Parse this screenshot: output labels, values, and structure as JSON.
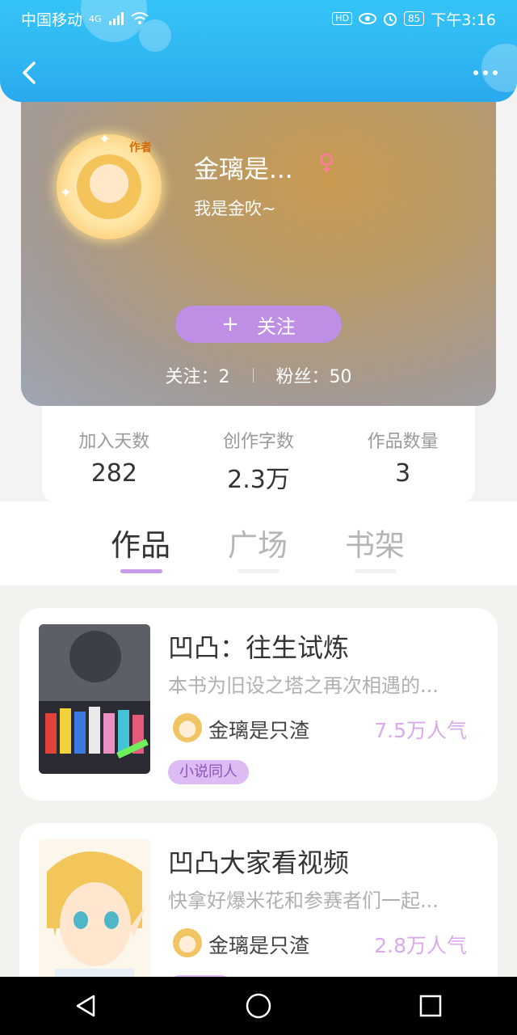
{
  "status_bar": {
    "carrier": "中国移动",
    "network": "4G",
    "hd": "HD",
    "battery": "85",
    "time": "下午3:16"
  },
  "profile": {
    "author_badge": "作者",
    "name": "金璃是...",
    "gender_symbol": "♀",
    "bio": "我是金吹~",
    "follow_plus": "+",
    "follow_label": "关注",
    "following": "关注：2",
    "fans": "粉丝：50"
  },
  "stats": [
    {
      "label": "加入天数",
      "value": "282"
    },
    {
      "label": "创作字数",
      "value": "2.3万"
    },
    {
      "label": "作品数量",
      "value": "3"
    }
  ],
  "tabs": [
    {
      "label": "作品",
      "active": true
    },
    {
      "label": "广场",
      "active": false
    },
    {
      "label": "书架",
      "active": false
    }
  ],
  "works": [
    {
      "title": "凹凸：往生试炼",
      "desc": "本书为旧设之塔之再次相遇的...",
      "author": "金璃是只渣",
      "popularity": "7.5万人气",
      "tag": "小说同人"
    },
    {
      "title": "凹凸大家看视频",
      "desc": "快拿好爆米花和参赛者们一起...",
      "author": "金璃是只渣",
      "popularity": "2.8万人气",
      "tag": ""
    }
  ],
  "colors": {
    "header": "#2fb6f2",
    "accent": "#c79ce8",
    "popularity": "#d9a9ec"
  },
  "icons": [
    "back-icon",
    "more-icon",
    "female-icon",
    "nav-back-icon",
    "nav-home-icon",
    "nav-recent-icon"
  ]
}
